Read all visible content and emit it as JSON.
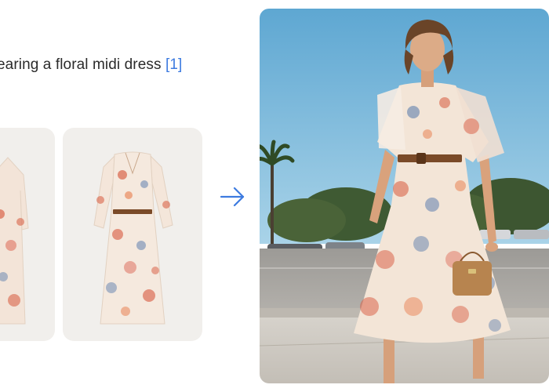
{
  "caption": {
    "text": "earing a floral midi dress",
    "ref": "[1]"
  },
  "colors": {
    "accent": "#3d7be0",
    "card_bg": "#f1efec",
    "sky": "#6fb1d6",
    "pavement": "#c9c6c0",
    "dress_base": "#f3e8dc",
    "floral_red": "#d9644a",
    "floral_blue": "#5f7fae",
    "belt": "#7a4a28"
  },
  "icons": {
    "arrow": "arrow-right-icon"
  }
}
